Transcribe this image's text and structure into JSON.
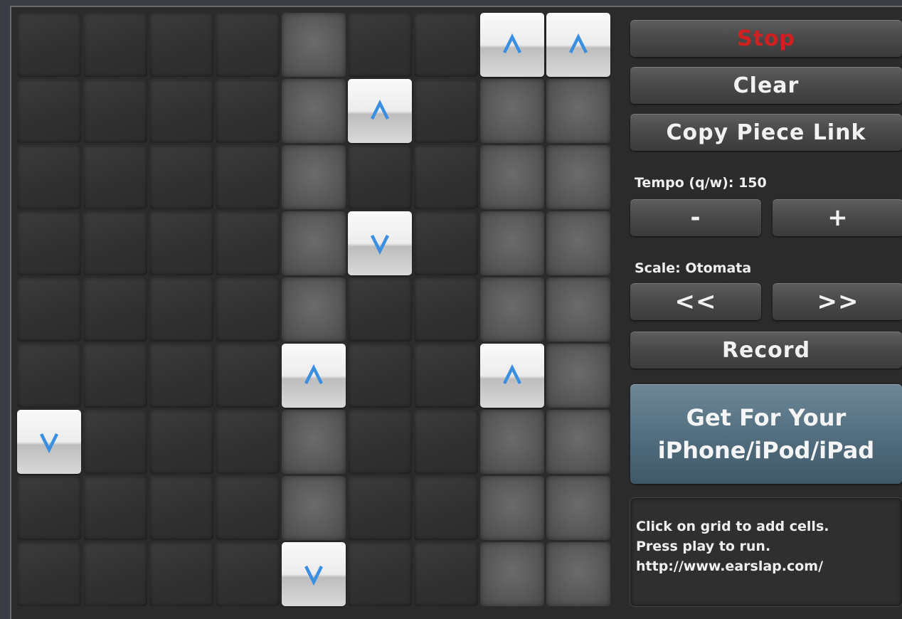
{
  "grid": {
    "columns": 9,
    "rows": 9,
    "highlighted_columns": [
      4,
      7,
      8
    ],
    "cells": [
      {
        "row": 0,
        "col": 7,
        "dir": "up"
      },
      {
        "row": 0,
        "col": 8,
        "dir": "up"
      },
      {
        "row": 1,
        "col": 5,
        "dir": "up"
      },
      {
        "row": 3,
        "col": 5,
        "dir": "down"
      },
      {
        "row": 5,
        "col": 4,
        "dir": "up"
      },
      {
        "row": 5,
        "col": 7,
        "dir": "up"
      },
      {
        "row": 6,
        "col": 0,
        "dir": "down"
      },
      {
        "row": 8,
        "col": 4,
        "dir": "down"
      }
    ]
  },
  "controls": {
    "stop_label": "Stop",
    "clear_label": "Clear",
    "copy_link_label": "Copy Piece Link",
    "tempo_label": "Tempo (q/w): 150",
    "tempo_minus": "-",
    "tempo_plus": "+",
    "scale_label": "Scale: Otomata",
    "scale_prev": "<<",
    "scale_next": ">>",
    "record_label": "Record"
  },
  "promo": {
    "line1": "Get For Your",
    "line2": "iPhone/iPod/iPad"
  },
  "info": {
    "line1": "Click on grid to add cells.",
    "line2": "Press play to run.",
    "line3": "http://www.earslap.com/"
  },
  "colors": {
    "arrow": "#3a8fe0",
    "stop_text": "#d02020"
  }
}
